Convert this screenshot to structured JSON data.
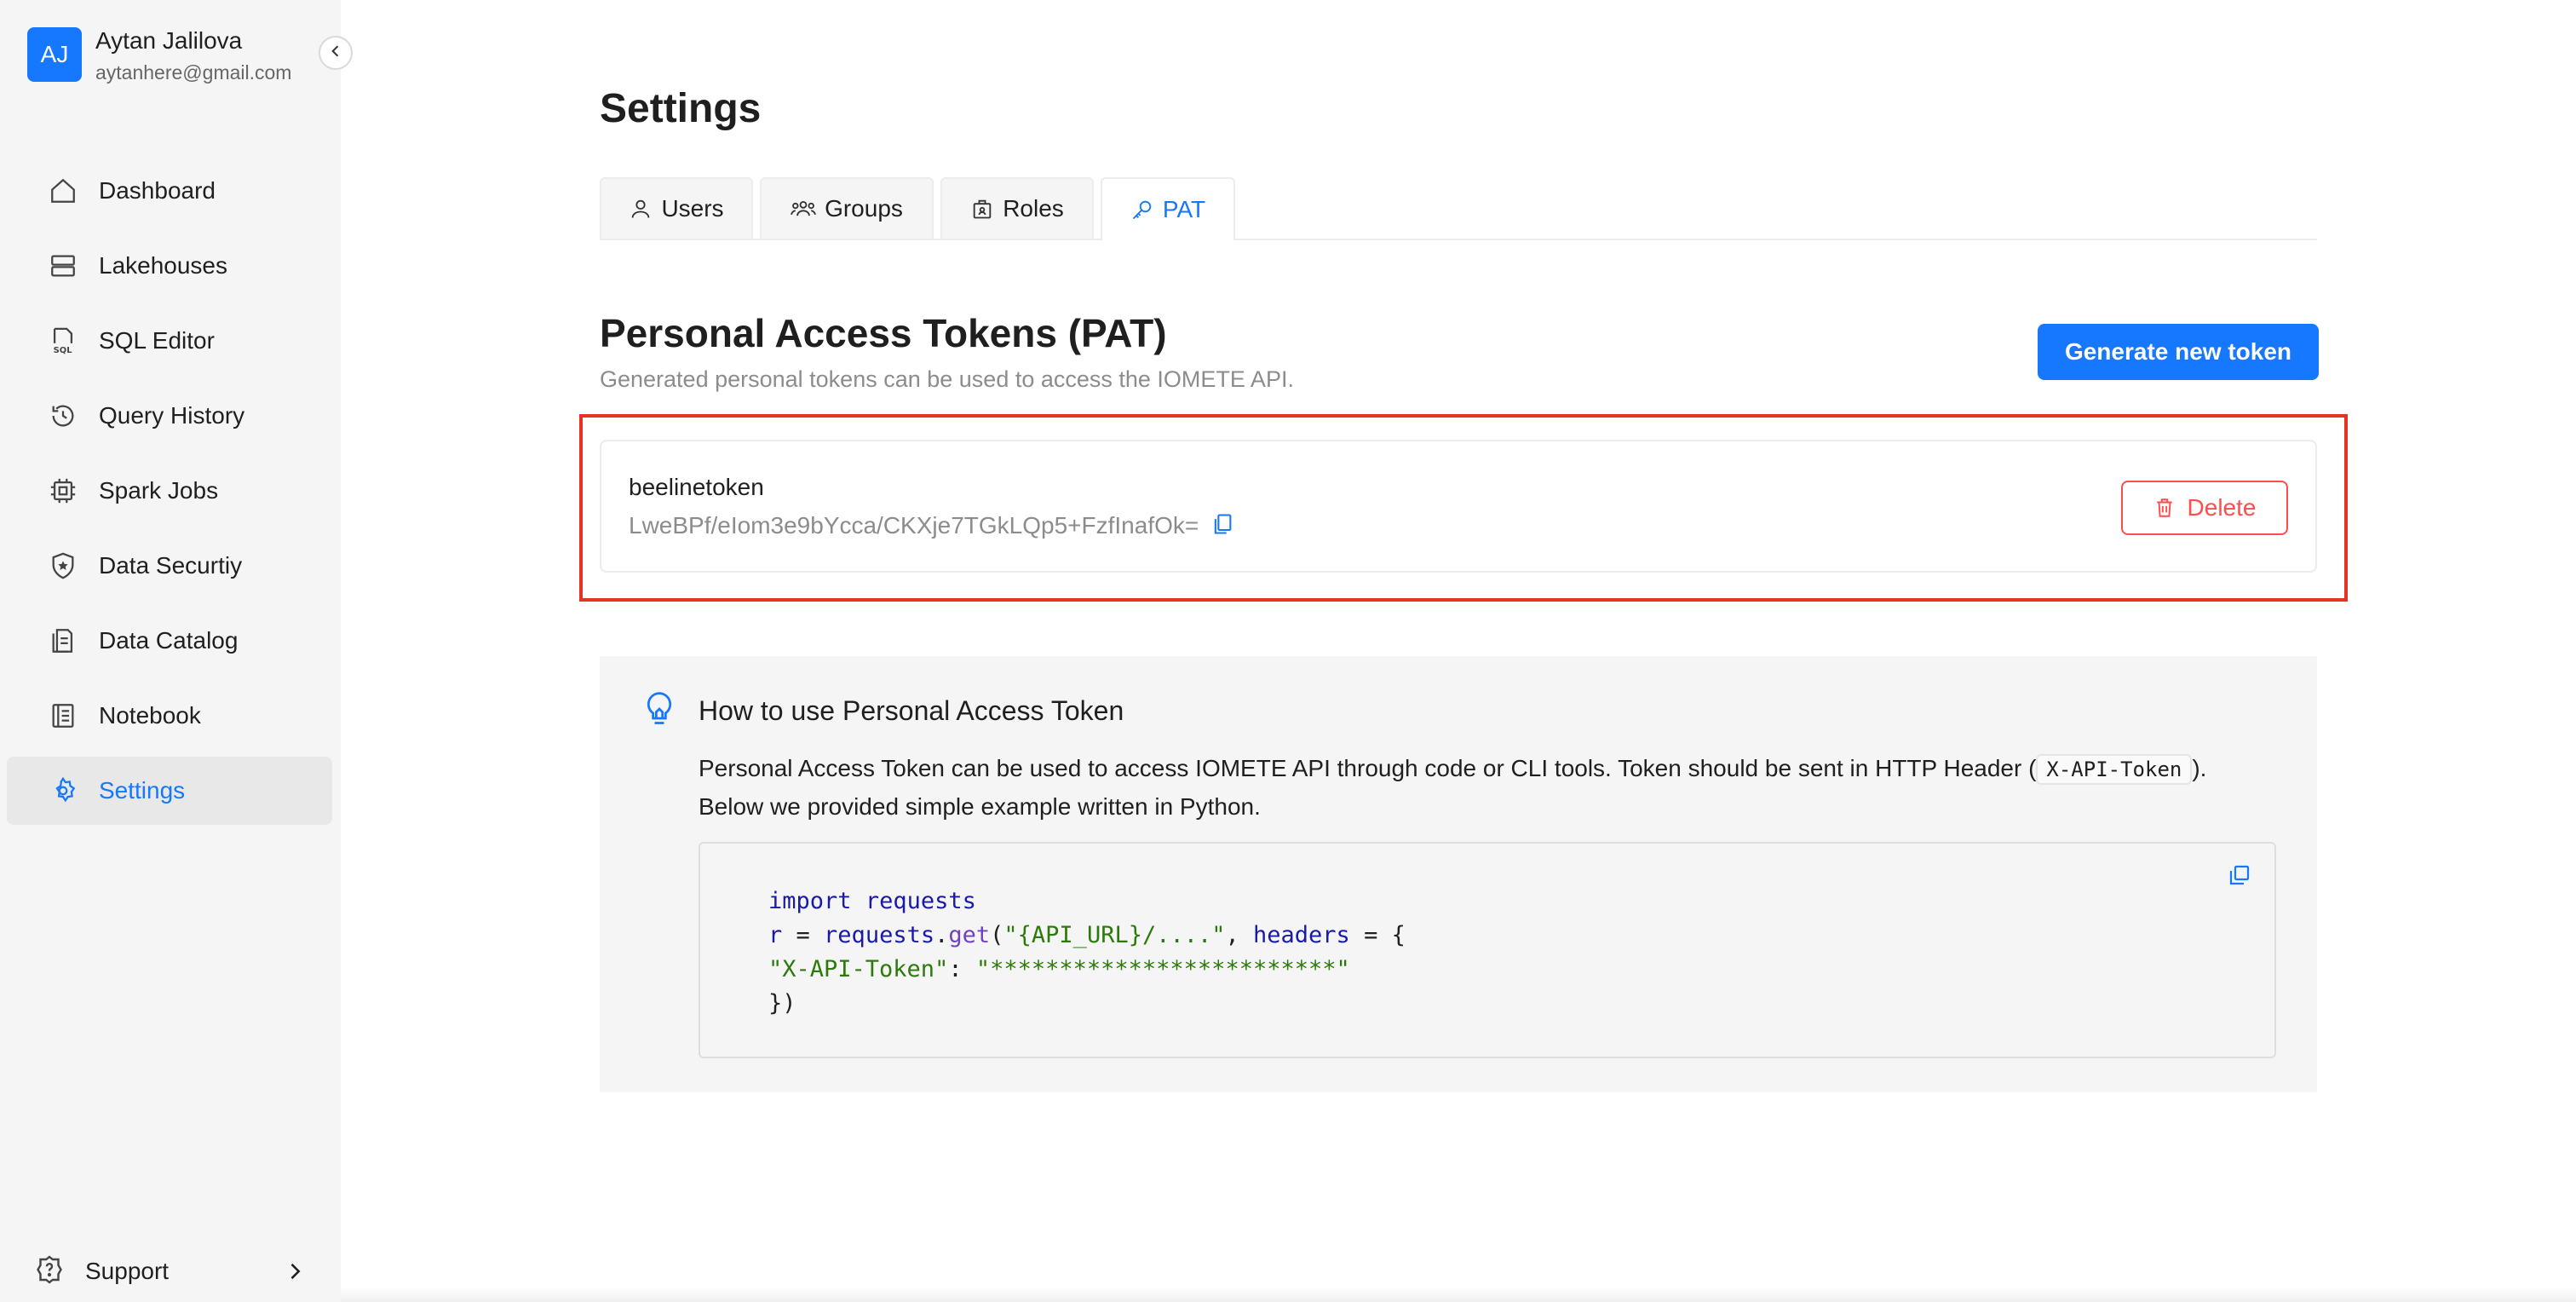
{
  "user": {
    "initials": "AJ",
    "name": "Aytan Jalilova",
    "email": "aytanhere@gmail.com"
  },
  "nav": {
    "items": [
      {
        "label": "Dashboard",
        "icon": "home-icon"
      },
      {
        "label": "Lakehouses",
        "icon": "server-icon"
      },
      {
        "label": "SQL Editor",
        "icon": "sql-file-icon"
      },
      {
        "label": "Query History",
        "icon": "history-icon"
      },
      {
        "label": "Spark Jobs",
        "icon": "chip-icon"
      },
      {
        "label": "Data Securtiy",
        "icon": "shield-icon"
      },
      {
        "label": "Data Catalog",
        "icon": "catalog-icon"
      },
      {
        "label": "Notebook",
        "icon": "notebook-icon"
      },
      {
        "label": "Settings",
        "icon": "gear-icon",
        "active": true
      }
    ],
    "support_label": "Support"
  },
  "page": {
    "title": "Settings"
  },
  "tabs": [
    {
      "label": "Users",
      "icon": "user-icon"
    },
    {
      "label": "Groups",
      "icon": "group-icon"
    },
    {
      "label": "Roles",
      "icon": "role-icon"
    },
    {
      "label": "PAT",
      "icon": "key-icon",
      "active": true
    }
  ],
  "pat": {
    "title": "Personal Access Tokens (PAT)",
    "subtitle": "Generated personal tokens can be used to access the IOMETE API.",
    "generate_label": "Generate new token",
    "token": {
      "name": "beelinetoken",
      "value": "LweBPf/eIom3e9bYcca/CKXje7TGkLQp5+FzfInafOk=",
      "delete_label": "Delete"
    }
  },
  "howto": {
    "title": "How to use Personal Access Token",
    "text_before": "Personal Access Token can be used to access IOMETE API through code or CLI tools. Token should be sent in HTTP Header (",
    "header_name": "X-API-Token",
    "text_after": ").",
    "text_line2": "Below we provided simple example written in Python.",
    "code": {
      "l1_kw": "import",
      "l1_mod": "requests",
      "l2_var": "r",
      "l2_eq": " = ",
      "l2_obj": "requests",
      "l2_dot": ".",
      "l2_fn": "get",
      "l2_open": "(",
      "l2_str": "\"{API_URL}/....\"",
      "l2_comma": ", ",
      "l2_kwarg": "headers",
      "l2_rest": " = {",
      "l3_key": "\"X-API-Token\"",
      "l3_colon": ": ",
      "l3_val": "\"*************************\"",
      "l4": "})"
    }
  },
  "colors": {
    "accent": "#1677ff",
    "danger": "#ff4d4f",
    "highlight": "#e53222"
  }
}
